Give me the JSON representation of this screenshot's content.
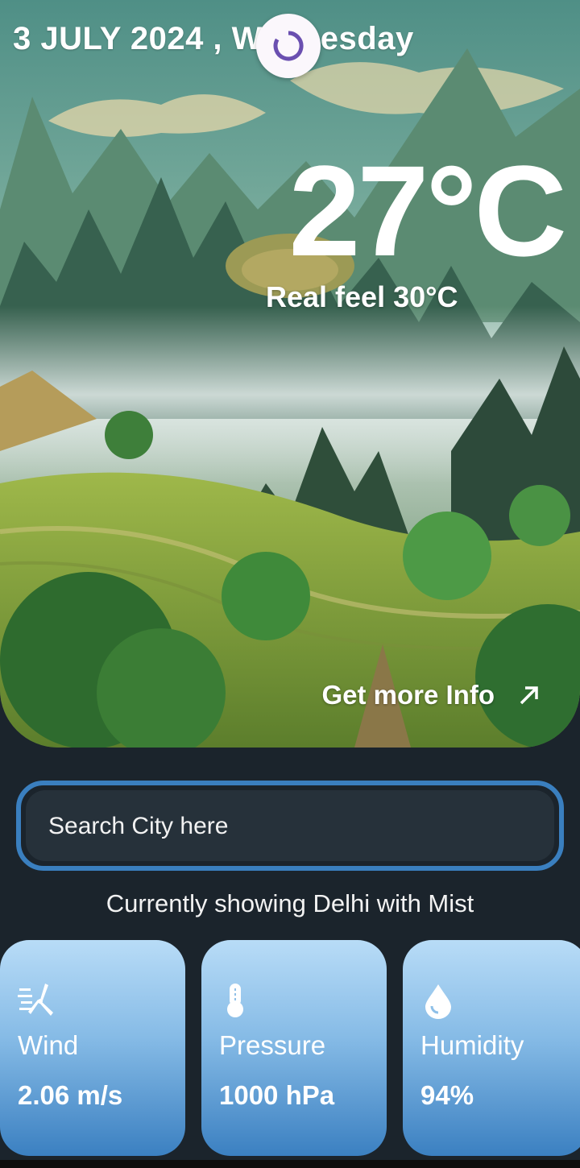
{
  "header": {
    "date": "3 JULY 2024 , Wednesday"
  },
  "weather": {
    "temperature": "27°C",
    "real_feel": "Real feel 30°C",
    "more_info_label": "Get more Info"
  },
  "search": {
    "placeholder": "Search City here"
  },
  "status": {
    "text": "Currently showing Delhi with Mist"
  },
  "cards": [
    {
      "icon": "wind-turbine-icon",
      "label": "Wind",
      "value": "2.06 m/s"
    },
    {
      "icon": "thermometer-icon",
      "label": "Pressure",
      "value": "1000 hPa"
    },
    {
      "icon": "water-drop-icon",
      "label": "Humidity",
      "value": "94%"
    }
  ],
  "colors": {
    "background": "#1b242c",
    "accent_border": "#3a7fbf",
    "spinner": "#6a4fb0",
    "card_gradient_top": "#b8dcf7",
    "card_gradient_bottom": "#3b80c1"
  }
}
